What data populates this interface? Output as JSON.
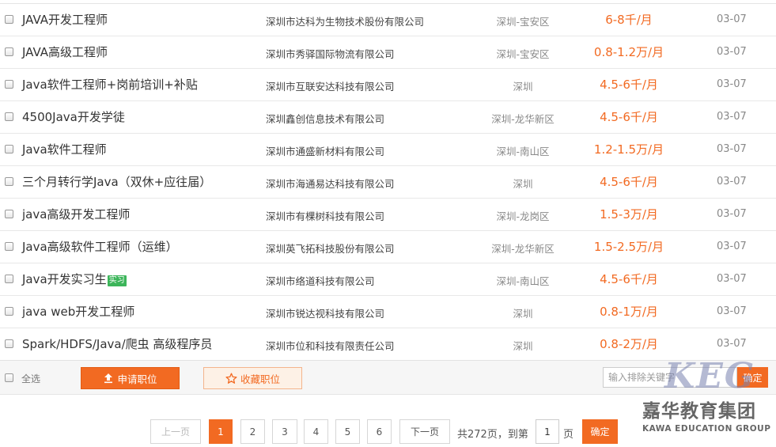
{
  "jobs": [
    {
      "title": "JAVA开发工程师",
      "tag": "",
      "company": "深圳市达科为生物技术股份有限公司",
      "location": "深圳-宝安区",
      "salary": "6-8千/月",
      "date": "03-07"
    },
    {
      "title": "JAVA高级工程师",
      "tag": "",
      "company": "深圳市秀驿国际物流有限公司",
      "location": "深圳-宝安区",
      "salary": "0.8-1.2万/月",
      "date": "03-07"
    },
    {
      "title": "Java软件工程师+岗前培训+补贴",
      "tag": "",
      "company": "深圳市互联安达科技有限公司",
      "location": "深圳",
      "salary": "4.5-6千/月",
      "date": "03-07"
    },
    {
      "title": "4500Java开发学徒",
      "tag": "",
      "company": "深圳鑫创信息技术有限公司",
      "location": "深圳-龙华新区",
      "salary": "4.5-6千/月",
      "date": "03-07"
    },
    {
      "title": "Java软件工程师",
      "tag": "",
      "company": "深圳市通盛新材料有限公司",
      "location": "深圳-南山区",
      "salary": "1.2-1.5万/月",
      "date": "03-07"
    },
    {
      "title": "三个月转行学Java（双休+应往届）",
      "tag": "",
      "company": "深圳市海通易达科技有限公司",
      "location": "深圳",
      "salary": "4.5-6千/月",
      "date": "03-07"
    },
    {
      "title": "java高级开发工程师",
      "tag": "",
      "company": "深圳市有棵树科技有限公司",
      "location": "深圳-龙岗区",
      "salary": "1.5-3万/月",
      "date": "03-07"
    },
    {
      "title": "Java高级软件工程师（运维）",
      "tag": "",
      "company": "深圳英飞拓科技股份有限公司",
      "location": "深圳-龙华新区",
      "salary": "1.5-2.5万/月",
      "date": "03-07"
    },
    {
      "title": "Java开发实习生",
      "tag": "实习",
      "company": "深圳市络道科技有限公司",
      "location": "深圳-南山区",
      "salary": "4.5-6千/月",
      "date": "03-07"
    },
    {
      "title": "java web开发工程师",
      "tag": "",
      "company": "深圳市锐达视科技有限公司",
      "location": "深圳",
      "salary": "0.8-1万/月",
      "date": "03-07"
    },
    {
      "title": "Spark/HDFS/Java/爬虫 高级程序员",
      "tag": "",
      "company": "深圳市位和科技有限责任公司",
      "location": "深圳",
      "salary": "0.8-2万/月",
      "date": "03-07"
    }
  ],
  "actions": {
    "select_all": "全选",
    "apply": "申请职位",
    "favorite": "收藏职位",
    "exclude_placeholder": "输入排除关键字",
    "confirm": "确定"
  },
  "pagination": {
    "prev": "上一页",
    "pages": [
      "1",
      "2",
      "3",
      "4",
      "5",
      "6"
    ],
    "current": "1",
    "next": "下一页",
    "total_text": "共272页，到第",
    "goto_value": "1",
    "page_unit": "页",
    "go": "确定"
  },
  "watermark": {
    "logo": "KEG",
    "name_cn": "嘉华教育集团",
    "name_en": "KAWA EDUCATION GROUP"
  },
  "colors": {
    "accent": "#f26a22",
    "tag_green": "#3cb55a",
    "muted_text": "#888888"
  }
}
